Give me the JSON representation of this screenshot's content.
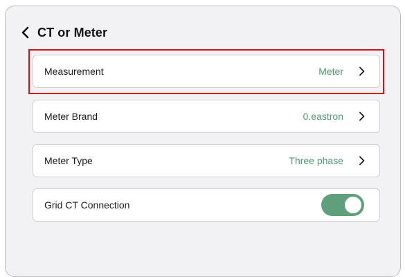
{
  "header": {
    "title": "CT or Meter",
    "back_icon": "chevron-left-icon"
  },
  "rows": [
    {
      "label": "Measurement",
      "value": "Meter",
      "icon": "chevron-right-icon"
    },
    {
      "label": "Meter Brand",
      "value": "0.eastron",
      "icon": "chevron-right-icon"
    },
    {
      "label": "Meter Type",
      "value": "Three phase",
      "icon": "chevron-right-icon"
    },
    {
      "label": "Grid CT Connection",
      "toggle_on": true
    }
  ],
  "colors": {
    "accent_green": "#5f9f7b",
    "value_green": "#4f9a6f",
    "highlight_red": "#d0141b",
    "panel_bg": "#f2f2f4"
  }
}
